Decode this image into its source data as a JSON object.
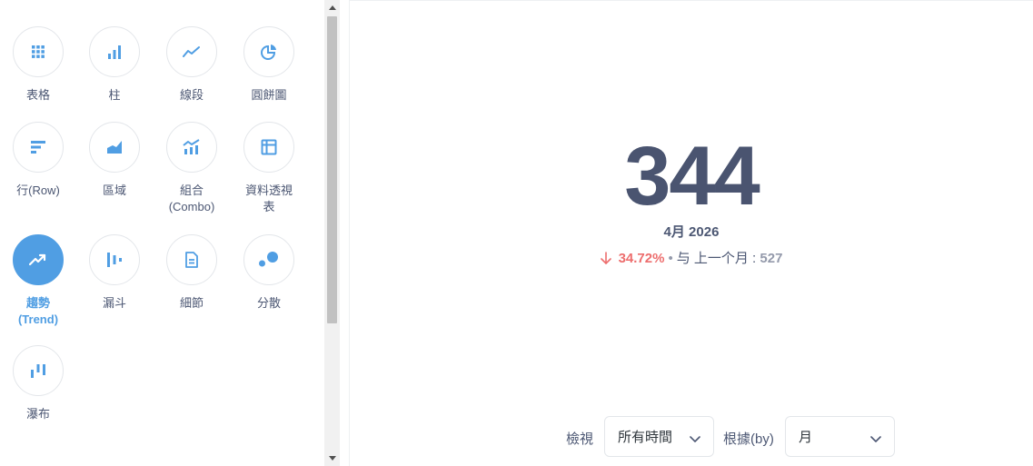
{
  "sidebar": {
    "items": [
      {
        "label": "表格",
        "icon": "grid-icon"
      },
      {
        "label": "柱",
        "icon": "bar-chart-icon"
      },
      {
        "label": "線段",
        "icon": "line-chart-icon"
      },
      {
        "label": "圓餅圖",
        "icon": "pie-chart-icon"
      },
      {
        "label": "行(Row)",
        "icon": "row-chart-icon"
      },
      {
        "label": "區域",
        "icon": "area-chart-icon"
      },
      {
        "label": "組合\n(Combo)",
        "icon": "combo-chart-icon"
      },
      {
        "label": "資料透視\n表",
        "icon": "pivot-table-icon"
      },
      {
        "label": "趨勢\n(Trend)",
        "icon": "trend-icon",
        "selected": true
      },
      {
        "label": "漏斗",
        "icon": "funnel-icon"
      },
      {
        "label": "細節",
        "icon": "document-icon"
      },
      {
        "label": "分散",
        "icon": "scatter-icon"
      },
      {
        "label": "瀑布",
        "icon": "waterfall-icon"
      }
    ]
  },
  "trend": {
    "value": "344",
    "period": "4月 2026",
    "change_pct": "34.72%",
    "change_direction": "down",
    "compare_label": "与 上一个月 :",
    "previous_value": "527"
  },
  "controls": {
    "view_label": "檢視",
    "view_value": "所有時間",
    "by_label": "根據(by)",
    "by_value": "月"
  },
  "colors": {
    "accent": "#509ee3",
    "value_text": "#4a5470",
    "negative": "#ed6e6e",
    "muted": "#949aab"
  }
}
